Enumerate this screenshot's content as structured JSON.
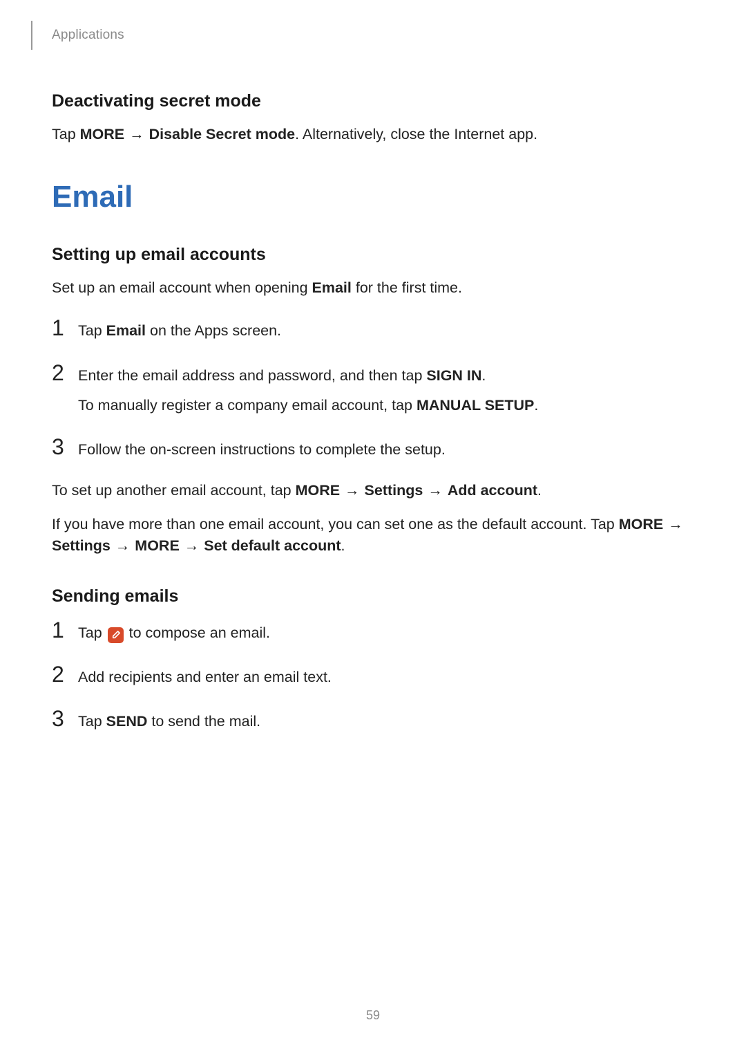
{
  "header": {
    "section_label": "Applications"
  },
  "deactivating": {
    "heading": "Deactivating secret mode",
    "p1_pre": "Tap ",
    "p1_b1": "MORE",
    "p1_arrow": " → ",
    "p1_b2": "Disable Secret mode",
    "p1_post": ". Alternatively, close the Internet app."
  },
  "email": {
    "heading": "Email"
  },
  "setup": {
    "heading": "Setting up email accounts",
    "intro_pre": "Set up an email account when opening ",
    "intro_b": "Email",
    "intro_post": " for the first time.",
    "step1_pre": "Tap ",
    "step1_b": "Email",
    "step1_post": " on the Apps screen.",
    "step2_line1_pre": "Enter the email address and password, and then tap ",
    "step2_line1_b": "SIGN IN",
    "step2_line1_post": ".",
    "step2_line2_pre": "To manually register a company email account, tap ",
    "step2_line2_b": "MANUAL SETUP",
    "step2_line2_post": ".",
    "step3": "Follow the on-screen instructions to complete the setup.",
    "after1_pre": "To set up another email account, tap ",
    "after1_b1": "MORE",
    "after1_arrow1": " → ",
    "after1_b2": "Settings",
    "after1_arrow2": " → ",
    "after1_b3": "Add account",
    "after1_post": ".",
    "after2_pre": "If you have more than one email account, you can set one as the default account. Tap ",
    "after2_b1": "MORE",
    "after2_arrow1": " → ",
    "after2_b2": "Settings",
    "after2_arrow2": " → ",
    "after2_b3": "MORE",
    "after2_arrow3": " → ",
    "after2_b4": "Set default account",
    "after2_post": "."
  },
  "sending": {
    "heading": "Sending emails",
    "step1_pre": "Tap ",
    "step1_post": " to compose an email.",
    "step2": "Add recipients and enter an email text.",
    "step3_pre": "Tap ",
    "step3_b": "SEND",
    "step3_post": " to send the mail."
  },
  "nums": {
    "n1": "1",
    "n2": "2",
    "n3": "3"
  },
  "page_number": "59"
}
